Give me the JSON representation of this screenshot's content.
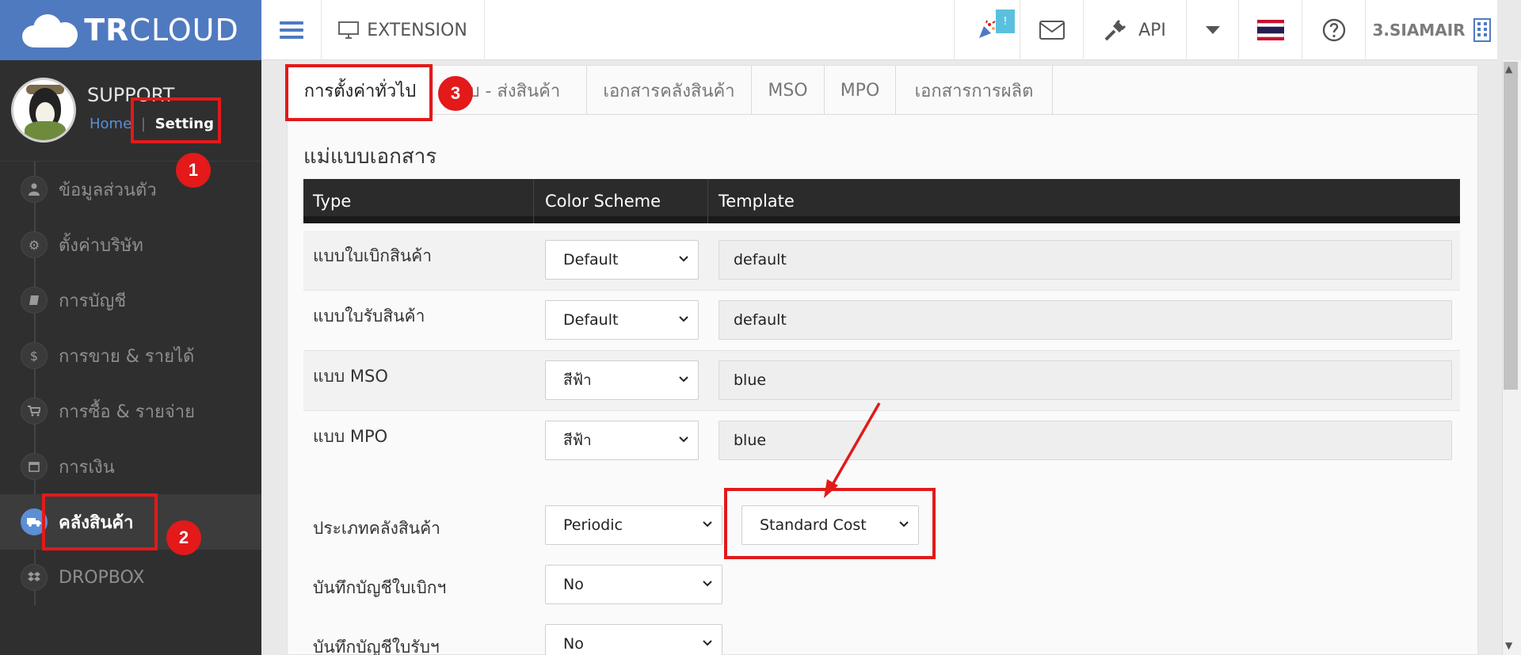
{
  "logo": {
    "bold": "TR",
    "rest": "CLOUD"
  },
  "profile": {
    "name": "SUPPORT",
    "home": "Home",
    "separator": "|",
    "setting": "Setting"
  },
  "sidebar": {
    "items": [
      {
        "label": "ข้อมูลส่วนตัว",
        "icon": "user-icon"
      },
      {
        "label": "ตั้งค่าบริษัท",
        "icon": "gear-icon"
      },
      {
        "label": "การบัญชี",
        "icon": "book-icon"
      },
      {
        "label": "การขาย & รายได้",
        "icon": "dollar-icon"
      },
      {
        "label": "การซื้อ & รายจ่าย",
        "icon": "cart-icon"
      },
      {
        "label": "การเงิน",
        "icon": "calendar-icon"
      },
      {
        "label": "คลังสินค้า",
        "icon": "truck-icon",
        "active": true
      },
      {
        "label": "DROPBOX",
        "icon": "dropbox-icon"
      }
    ]
  },
  "topbar": {
    "extension": "EXTENSION",
    "badge": "!",
    "api": "API",
    "company": "3.SIAMAIR"
  },
  "tabs": [
    "การตั้งค่าทั่วไป",
    "รับ - ส่งสินค้า",
    "เอกสารคลังสินค้า",
    "MSO",
    "MPO",
    "เอกสารการผลิต"
  ],
  "section": {
    "title": "แม่แบบเอกสาร"
  },
  "table": {
    "headers": [
      "Type",
      "Color Scheme",
      "Template"
    ],
    "rows": [
      {
        "type": "แบบใบเบิกสินค้า",
        "scheme": "Default",
        "template": "default"
      },
      {
        "type": "แบบใบรับสินค้า",
        "scheme": "Default",
        "template": "default"
      },
      {
        "type": "แบบ MSO",
        "scheme": "สีฟ้า",
        "template": "blue"
      },
      {
        "type": "แบบ MPO",
        "scheme": "สีฟ้า",
        "template": "blue"
      }
    ]
  },
  "fields": {
    "inventory_type": {
      "label": "ประเภทคลังสินค้า",
      "value": "Periodic",
      "cost_method": "Standard Cost"
    },
    "withdraw_post": {
      "label": "บันทึกบัญชีใบเบิกฯ",
      "value": "No"
    },
    "receive_post": {
      "label": "บันทึกบัญชีใบรับฯ",
      "value": "No"
    }
  },
  "annotations": {
    "n1": "1",
    "n2": "2",
    "n3": "3"
  },
  "colors": {
    "brand": "#4f7ac0",
    "sidebar": "#2f2f2f",
    "annotation": "#e3191a",
    "badge": "#5bc0de"
  }
}
